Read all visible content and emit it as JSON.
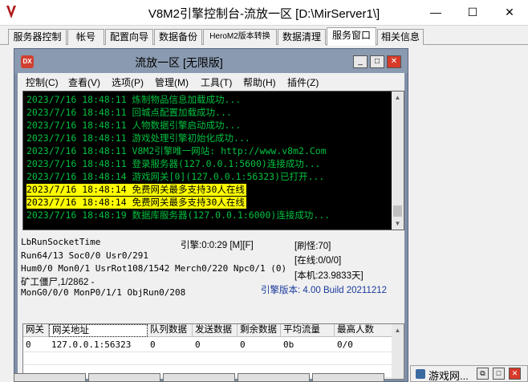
{
  "window": {
    "title": "V8M2引擎控制台-流放一区 [D:\\MirServer1\\]",
    "minimize": "—",
    "maximize": "☐",
    "close": "✕"
  },
  "tabs": [
    "服务器控制",
    "帐号",
    "配置向导",
    "数据备份",
    "HeroM2版本转换",
    "数据清理",
    "服务窗口",
    "相关信息"
  ],
  "active_tab": "服务窗口",
  "inner_window": {
    "icon_text": "DX",
    "title": "流放一区 [无限版]",
    "minimize": "_",
    "maximize": "□",
    "close": "✕"
  },
  "menu": [
    "控制(C)",
    "查看(V)",
    "选项(P)",
    "管理(M)",
    "工具(T)",
    "帮助(H)",
    "插件(Z)"
  ],
  "log": [
    {
      "text": "2023/7/16 18:48:11 炼制物品信息加载成功...",
      "highlight": false
    },
    {
      "text": "2023/7/16 18:48:11 回城点配置加载成功...",
      "highlight": false
    },
    {
      "text": "2023/7/16 18:48:11 人物数据引擎启动成功...",
      "highlight": false
    },
    {
      "text": "2023/7/16 18:48:11 游戏处理引擎初始化成功...",
      "highlight": false
    },
    {
      "text": "2023/7/16 18:48:11 V8M2引擎唯一网站: http://www.v8m2.Com",
      "highlight": false
    },
    {
      "text": "2023/7/16 18:48:11 登录服务器(127.0.0.1:5600)连接成功...",
      "highlight": false
    },
    {
      "text": "2023/7/16 18:48:14 游戏网关[0](127.0.0.1:56323)已打开...",
      "highlight": false
    },
    {
      "text": "2023/7/16 18:48:14 免费网关最多支持30人在线",
      "highlight": true
    },
    {
      "text": "2023/7/16 18:48:14 免费网关最多支持30人在线",
      "highlight": true
    },
    {
      "text": "2023/7/16 18:48:19 数据库服务器(127.0.0.1:6000)连接成功...",
      "highlight": false
    }
  ],
  "status": {
    "lb_run": "LbRunSocketTime",
    "engine_time": "引擎:0:0:29 [M][F]",
    "refresh": "[刷怪:70]",
    "run": "Run64/13 Soc0/0 Usr0/291",
    "online": "[在线:0/0/0]",
    "hum": "Hum0/0 Mon0/1 UsrRot108/1542 Merch0/220 Npc0/1 (0)",
    "local": "[本机:23.9833天]",
    "mine": "矿工僵尸,1/2862 -",
    "version": "引擎版本: 4.00 Build 20211212",
    "mongo": "MonG0/0/0 MonP0/1/1 ObjRun0/208"
  },
  "gateway": {
    "headers": [
      "网关",
      "网关地址",
      "队列数据",
      "发送数据",
      "剩余数据",
      "平均流量",
      "最高人数"
    ],
    "rows": [
      [
        "0",
        "127.0.0.1:56323",
        "0",
        "0",
        "0",
        "0b",
        "0/0"
      ]
    ]
  },
  "min_window": {
    "title": "游戏网...",
    "restore": "⧉",
    "maximize": "□",
    "close": "✕"
  },
  "colors": {
    "log_text": "#00c040",
    "log_highlight": "#ffff00",
    "log_bg": "#000000",
    "version_text": "#1a3a9c",
    "inner_frame": "#7f8fa6"
  }
}
